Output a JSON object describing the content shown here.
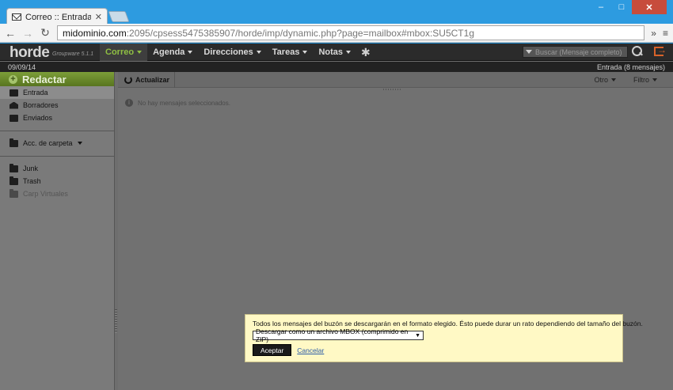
{
  "browser": {
    "tab_title": "Correo :: Entrada",
    "url_host": "midominio.com",
    "url_rest": ":2095/cpsess5475385907/horde/imp/dynamic.php?page=mailbox#mbox:SU5CT1g",
    "win_min": "–",
    "win_max": "□",
    "win_close": "✕",
    "overflow": "»",
    "menu": "≡"
  },
  "app": {
    "logo": "horde",
    "logo_sub": "Groupware 5.1.1",
    "menu": [
      {
        "label": "Correo"
      },
      {
        "label": "Agenda"
      },
      {
        "label": "Direcciones"
      },
      {
        "label": "Tareas"
      },
      {
        "label": "Notas"
      }
    ],
    "search_placeholder": "Buscar (Mensaje completo)",
    "date": "09/09/14",
    "mailbox_status": "Entrada (8 mensajes)"
  },
  "sidebar": {
    "compose": "Redactar",
    "folders": [
      {
        "label": "Entrada"
      },
      {
        "label": "Borradores"
      },
      {
        "label": "Enviados"
      }
    ],
    "folder_actions": "Acc. de carpeta",
    "other_folders": [
      {
        "label": "Junk"
      },
      {
        "label": "Trash"
      },
      {
        "label": "Carp Virtuales"
      }
    ]
  },
  "main": {
    "refresh": "Actualizar",
    "other": "Otro",
    "filter": "Filtro",
    "no_selection": "No hay mensajes seleccionados."
  },
  "dialog": {
    "text": "Todos los mensajes del buzón se descargarán en el formato elegido. Ésto puede durar un rato dependiendo del tamaño del buzón.",
    "select_value": "Descargar como un archivo MBOX (comprimido en ZIP)",
    "ok": "Aceptar",
    "cancel": "Cancelar"
  },
  "colors": {
    "accent_green": "#7c9e39",
    "dialog_bg": "#fff9c5",
    "window_blue": "#2d9be0"
  }
}
